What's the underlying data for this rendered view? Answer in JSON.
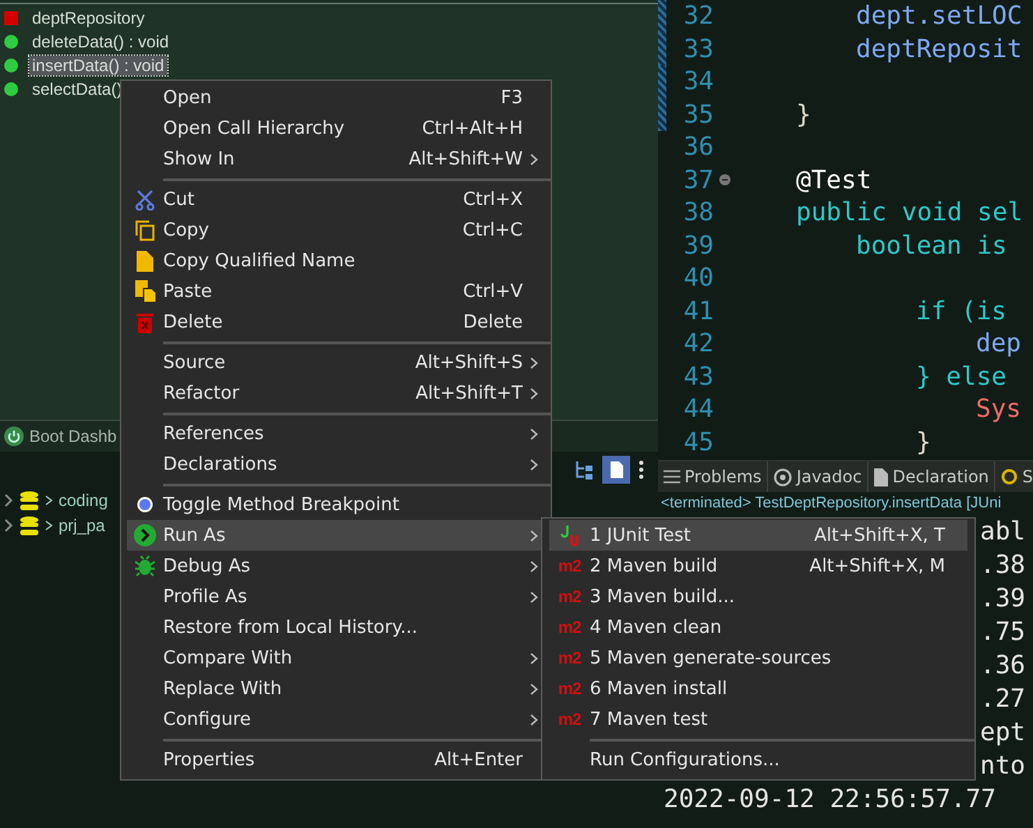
{
  "outline": {
    "items": [
      {
        "kind": "field",
        "label": "deptRepository",
        "selected": false
      },
      {
        "kind": "method",
        "label": "deleteData() : void",
        "selected": false
      },
      {
        "kind": "method",
        "label": "insertData() : void",
        "selected": true
      },
      {
        "kind": "method",
        "label": "selectData()",
        "selected": false
      }
    ]
  },
  "boot_dashboard": {
    "tab": "Boot Dashb",
    "tree": [
      {
        "label": "coding",
        "expanded": false
      },
      {
        "label": "prj_pa",
        "expanded": false
      }
    ]
  },
  "editor": {
    "lines": [
      {
        "number": "32",
        "kind": "statement",
        "code": "dept.setLOC",
        "color": "#7fa8f0",
        "changed": true
      },
      {
        "number": "33",
        "kind": "statement",
        "code": "deptReposit",
        "color": "#7fa8f0",
        "changed": true
      },
      {
        "number": "34",
        "changed": true
      },
      {
        "number": "35",
        "kind": "member",
        "code": "}",
        "color": "#e0d8c8",
        "changed": true
      },
      {
        "number": "36",
        "changed": false
      },
      {
        "number": "37",
        "kind": "member",
        "code": "@Test",
        "color": "#ffffff",
        "changed": false,
        "folded": false
      },
      {
        "number": "38",
        "kind": "member",
        "code": "public void sel",
        "color": "#2ec8c8",
        "changed": false
      },
      {
        "number": "39",
        "kind": "statement",
        "code": "boolean is",
        "color": "#2ec8c8",
        "changed": false
      },
      {
        "number": "40",
        "changed": false
      },
      {
        "number": "41",
        "kind": "block",
        "code": "if (is",
        "color": "#2ec8c8",
        "changed": false
      },
      {
        "number": "42",
        "kind": "nested",
        "code": "dep",
        "color": "#7fa8f0",
        "changed": false
      },
      {
        "number": "43",
        "kind": "block",
        "code": "} else",
        "color": "#2ec8c8",
        "changed": false
      },
      {
        "number": "44",
        "kind": "nested",
        "code": "Sys",
        "color": "#f06a6a",
        "changed": false
      },
      {
        "number": "45",
        "kind": "block",
        "code": "}",
        "color": "#e0d8c8",
        "changed": false
      }
    ]
  },
  "console": {
    "tabs": [
      {
        "label": "Problems",
        "selected": false
      },
      {
        "label": "Javadoc",
        "selected": false
      },
      {
        "label": "Declaration",
        "selected": false
      },
      {
        "label": "S",
        "selected": false
      }
    ],
    "status": "<terminated> TestDeptRepository.insertData [JUni",
    "lines": [
      {
        "kind": "tail",
        "text": "abl"
      },
      {
        "kind": "tail",
        "text": ".38"
      },
      {
        "kind": "tail",
        "text": ".39"
      },
      {
        "kind": "tail",
        "text": ".75"
      },
      {
        "kind": "tail",
        "text": ".36"
      },
      {
        "kind": "tail",
        "text": ".27"
      },
      {
        "kind": "tail",
        "text": "ept"
      },
      {
        "kind": "tail",
        "text": "nto"
      },
      {
        "kind": "full",
        "text": "2022-09-12 22:56:57.77"
      }
    ]
  },
  "context_menu": {
    "items": [
      {
        "kind": "plain",
        "label": "Open",
        "shortcut": "F3",
        "submenu": false,
        "selected": false
      },
      {
        "kind": "plain",
        "label": "Open Call Hierarchy",
        "shortcut": "Ctrl+Alt+H",
        "submenu": false,
        "selected": false
      },
      {
        "kind": "plain",
        "label": "Show In",
        "shortcut": "Alt+Shift+W",
        "submenu": true,
        "selected": false
      },
      {
        "kind": "separator"
      },
      {
        "kind": "cut",
        "label": "Cut",
        "shortcut": "Ctrl+X",
        "submenu": false,
        "selected": false
      },
      {
        "kind": "copy",
        "label": "Copy",
        "shortcut": "Ctrl+C",
        "submenu": false,
        "selected": false
      },
      {
        "kind": "document",
        "label": "Copy Qualified Name",
        "submenu": false,
        "selected": false
      },
      {
        "kind": "paste",
        "label": "Paste",
        "shortcut": "Ctrl+V",
        "submenu": false,
        "selected": false
      },
      {
        "kind": "delete",
        "label": "Delete",
        "shortcut": "Delete",
        "submenu": false,
        "selected": false
      },
      {
        "kind": "separator"
      },
      {
        "kind": "plain",
        "label": "Source",
        "shortcut": "Alt+Shift+S",
        "submenu": true,
        "selected": false
      },
      {
        "kind": "plain",
        "label": "Refactor",
        "shortcut": "Alt+Shift+T",
        "submenu": true,
        "selected": false
      },
      {
        "kind": "separator"
      },
      {
        "kind": "plain",
        "label": "References",
        "submenu": true,
        "selected": false
      },
      {
        "kind": "plain",
        "label": "Declarations",
        "submenu": true,
        "selected": false
      },
      {
        "kind": "separator"
      },
      {
        "kind": "breakpoint",
        "label": "Toggle Method Breakpoint",
        "submenu": false,
        "selected": false
      },
      {
        "kind": "run",
        "label": "Run As",
        "submenu": true,
        "selected": true
      },
      {
        "kind": "debug",
        "label": "Debug As",
        "submenu": true,
        "selected": false
      },
      {
        "kind": "plain",
        "label": "Profile As",
        "submenu": true,
        "selected": false
      },
      {
        "kind": "plain",
        "label": "Restore from Local History...",
        "submenu": false,
        "selected": false
      },
      {
        "kind": "plain",
        "label": "Compare With",
        "submenu": true,
        "selected": false
      },
      {
        "kind": "plain",
        "label": "Replace With",
        "submenu": true,
        "selected": false
      },
      {
        "kind": "plain",
        "label": "Configure",
        "submenu": true,
        "selected": false
      },
      {
        "kind": "separator"
      },
      {
        "kind": "plain",
        "label": "Properties",
        "shortcut": "Alt+Enter",
        "submenu": false,
        "selected": false
      }
    ]
  },
  "run_as_menu": {
    "items": [
      {
        "kind": "junit",
        "label": "1 JUnit Test",
        "shortcut": "Alt+Shift+X, T",
        "selected": true
      },
      {
        "kind": "maven",
        "badge": "m2",
        "label": "2 Maven build",
        "shortcut": "Alt+Shift+X, M",
        "selected": false
      },
      {
        "kind": "maven",
        "badge": "m2",
        "label": "3 Maven build...",
        "selected": false
      },
      {
        "kind": "maven",
        "badge": "m2",
        "label": "4 Maven clean",
        "selected": false
      },
      {
        "kind": "maven",
        "badge": "m2",
        "label": "5 Maven generate-sources",
        "selected": false
      },
      {
        "kind": "maven",
        "badge": "m2",
        "label": "6 Maven install",
        "selected": false
      },
      {
        "kind": "maven",
        "badge": "m2",
        "label": "7 Maven test",
        "selected": false
      },
      {
        "kind": "separator"
      },
      {
        "kind": "plain",
        "label": "Run Configurations...",
        "selected": false
      }
    ]
  }
}
